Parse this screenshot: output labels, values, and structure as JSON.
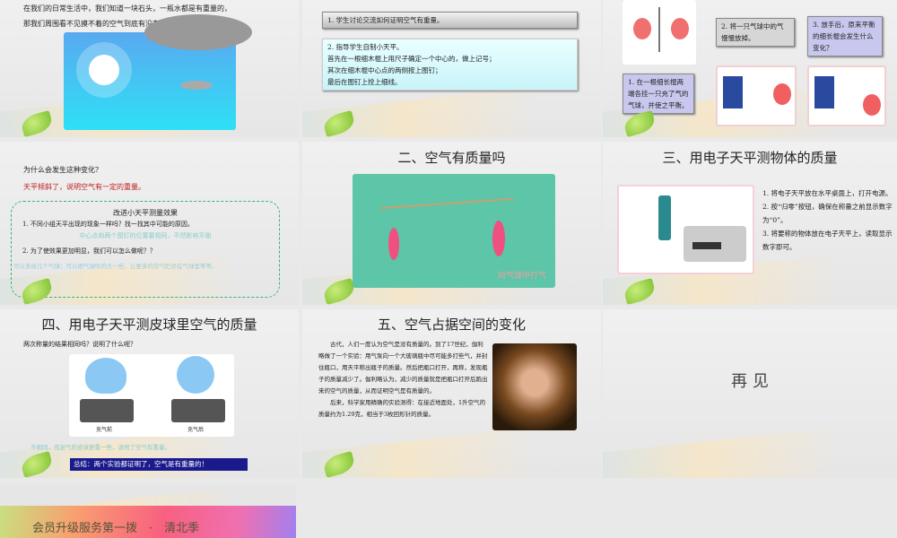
{
  "slides": [
    {
      "lines": [
        "在我们的日常生活中，我们知道一块石头，一瓶水都是有重量的，",
        "那我们周围看不见摸不着的空气到底有没有重量呢？"
      ]
    },
    {
      "box1": "1. 学生讨论交流如何证明空气有重量。",
      "box2": [
        "2. 指导学生自制小天平。",
        "首先在一根细木棍上用尺子确定一个中心的，做上记号；",
        "其次在细木棍中心点的两侧按上图钉；",
        "最后在图钉上拴上细线。"
      ]
    },
    {
      "step1": "1. 在一根细长棍两端各挂一只充了气的气球，并使之平衡。",
      "step2": "2. 将一只气球中的气慢慢放掉。",
      "step3": "3. 放手后，原来平衡的细长棍会发生什么变化？"
    },
    {
      "question": "为什么会发生这种变化？",
      "answer": "天平倾斜了，说明空气有一定的重量。",
      "box_title": "改进小天平测量效果",
      "q1": "1. 不同小组天平出现的现象一样吗？找一找其中可能的原因。",
      "a1": "中心点和两个图钉的位置要相同，不然影响平衡",
      "q2": "2. 为了使效果更加明显，我们可以怎么做呢？？",
      "a2": "可以多挂几个气球；可以把气球吹的大一些，让更多的空气贮存在气球里等等。"
    },
    {
      "title": "二、空气有质量吗",
      "caption": "向气球中打气"
    },
    {
      "title": "三、用电子天平测物体的质量",
      "steps": [
        "1. 将电子天平放在水平桌面上，打开电源。",
        "2. 按“归零”按钮，确保在称量之前显示数字为“0”。",
        "3. 将要称的物体放在电子天平上，读取显示数字即可。"
      ]
    },
    {
      "title": "四、用电子天平测皮球里空气的质量",
      "question": "两次称量的结果相同吗？说明了什么呢？",
      "label_before": "充气前",
      "label_after": "充气后",
      "answer": "不相同，充足气的皮球更重一些，说明了空气有重量。",
      "summary": "总结：两个实验都证明了，空气是有重量的！"
    },
    {
      "title": "五、空气占据空间的变化",
      "para1": "古代，人们一度认为空气是没有质量的。到了17世纪，伽利略做了一个实验：用气泵向一个大玻璃瓶中尽可能多打些气，并封住瓶口，用天平称出瓶子的质量。然后把瓶口打开，再称，发现瓶子的质量减少了。伽利略认为，减少的质量就是把瓶口打开后跑出来的空气的质量，从而证明空气是有质量的。",
      "para2": "后来，科学家用精确的实验测得：在接近地面处，1升空气的质量约为1.29克，相当于3枚回形针的质量。"
    },
    {
      "title": "再 见"
    },
    {
      "banner": "会员升级服务第一拨　·　清北季"
    }
  ]
}
